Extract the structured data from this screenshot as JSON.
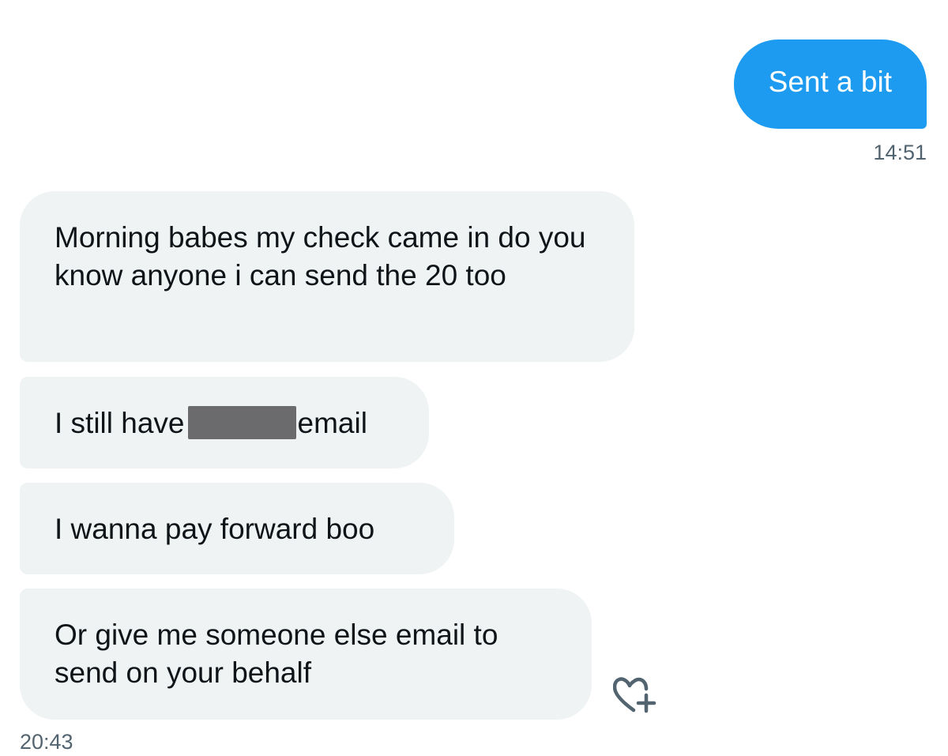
{
  "conversation": {
    "sent": {
      "text": "Sent a bit",
      "time": "14:51"
    },
    "received": {
      "m1": "Morning babes my check came in do you know anyone i can send the 20 too",
      "m2_before": "I still have",
      "m2_after": "email",
      "m3": "I wanna pay forward boo",
      "m4": "Or give me someone else email to send on your behalf",
      "time": "20:43"
    },
    "icons": {
      "react": "heart-plus-icon"
    },
    "colors": {
      "sent_bubble": "#1d9bf0",
      "received_bubble": "#eff3f4",
      "timestamp": "#536471",
      "redaction": "#6b6b6e"
    }
  }
}
